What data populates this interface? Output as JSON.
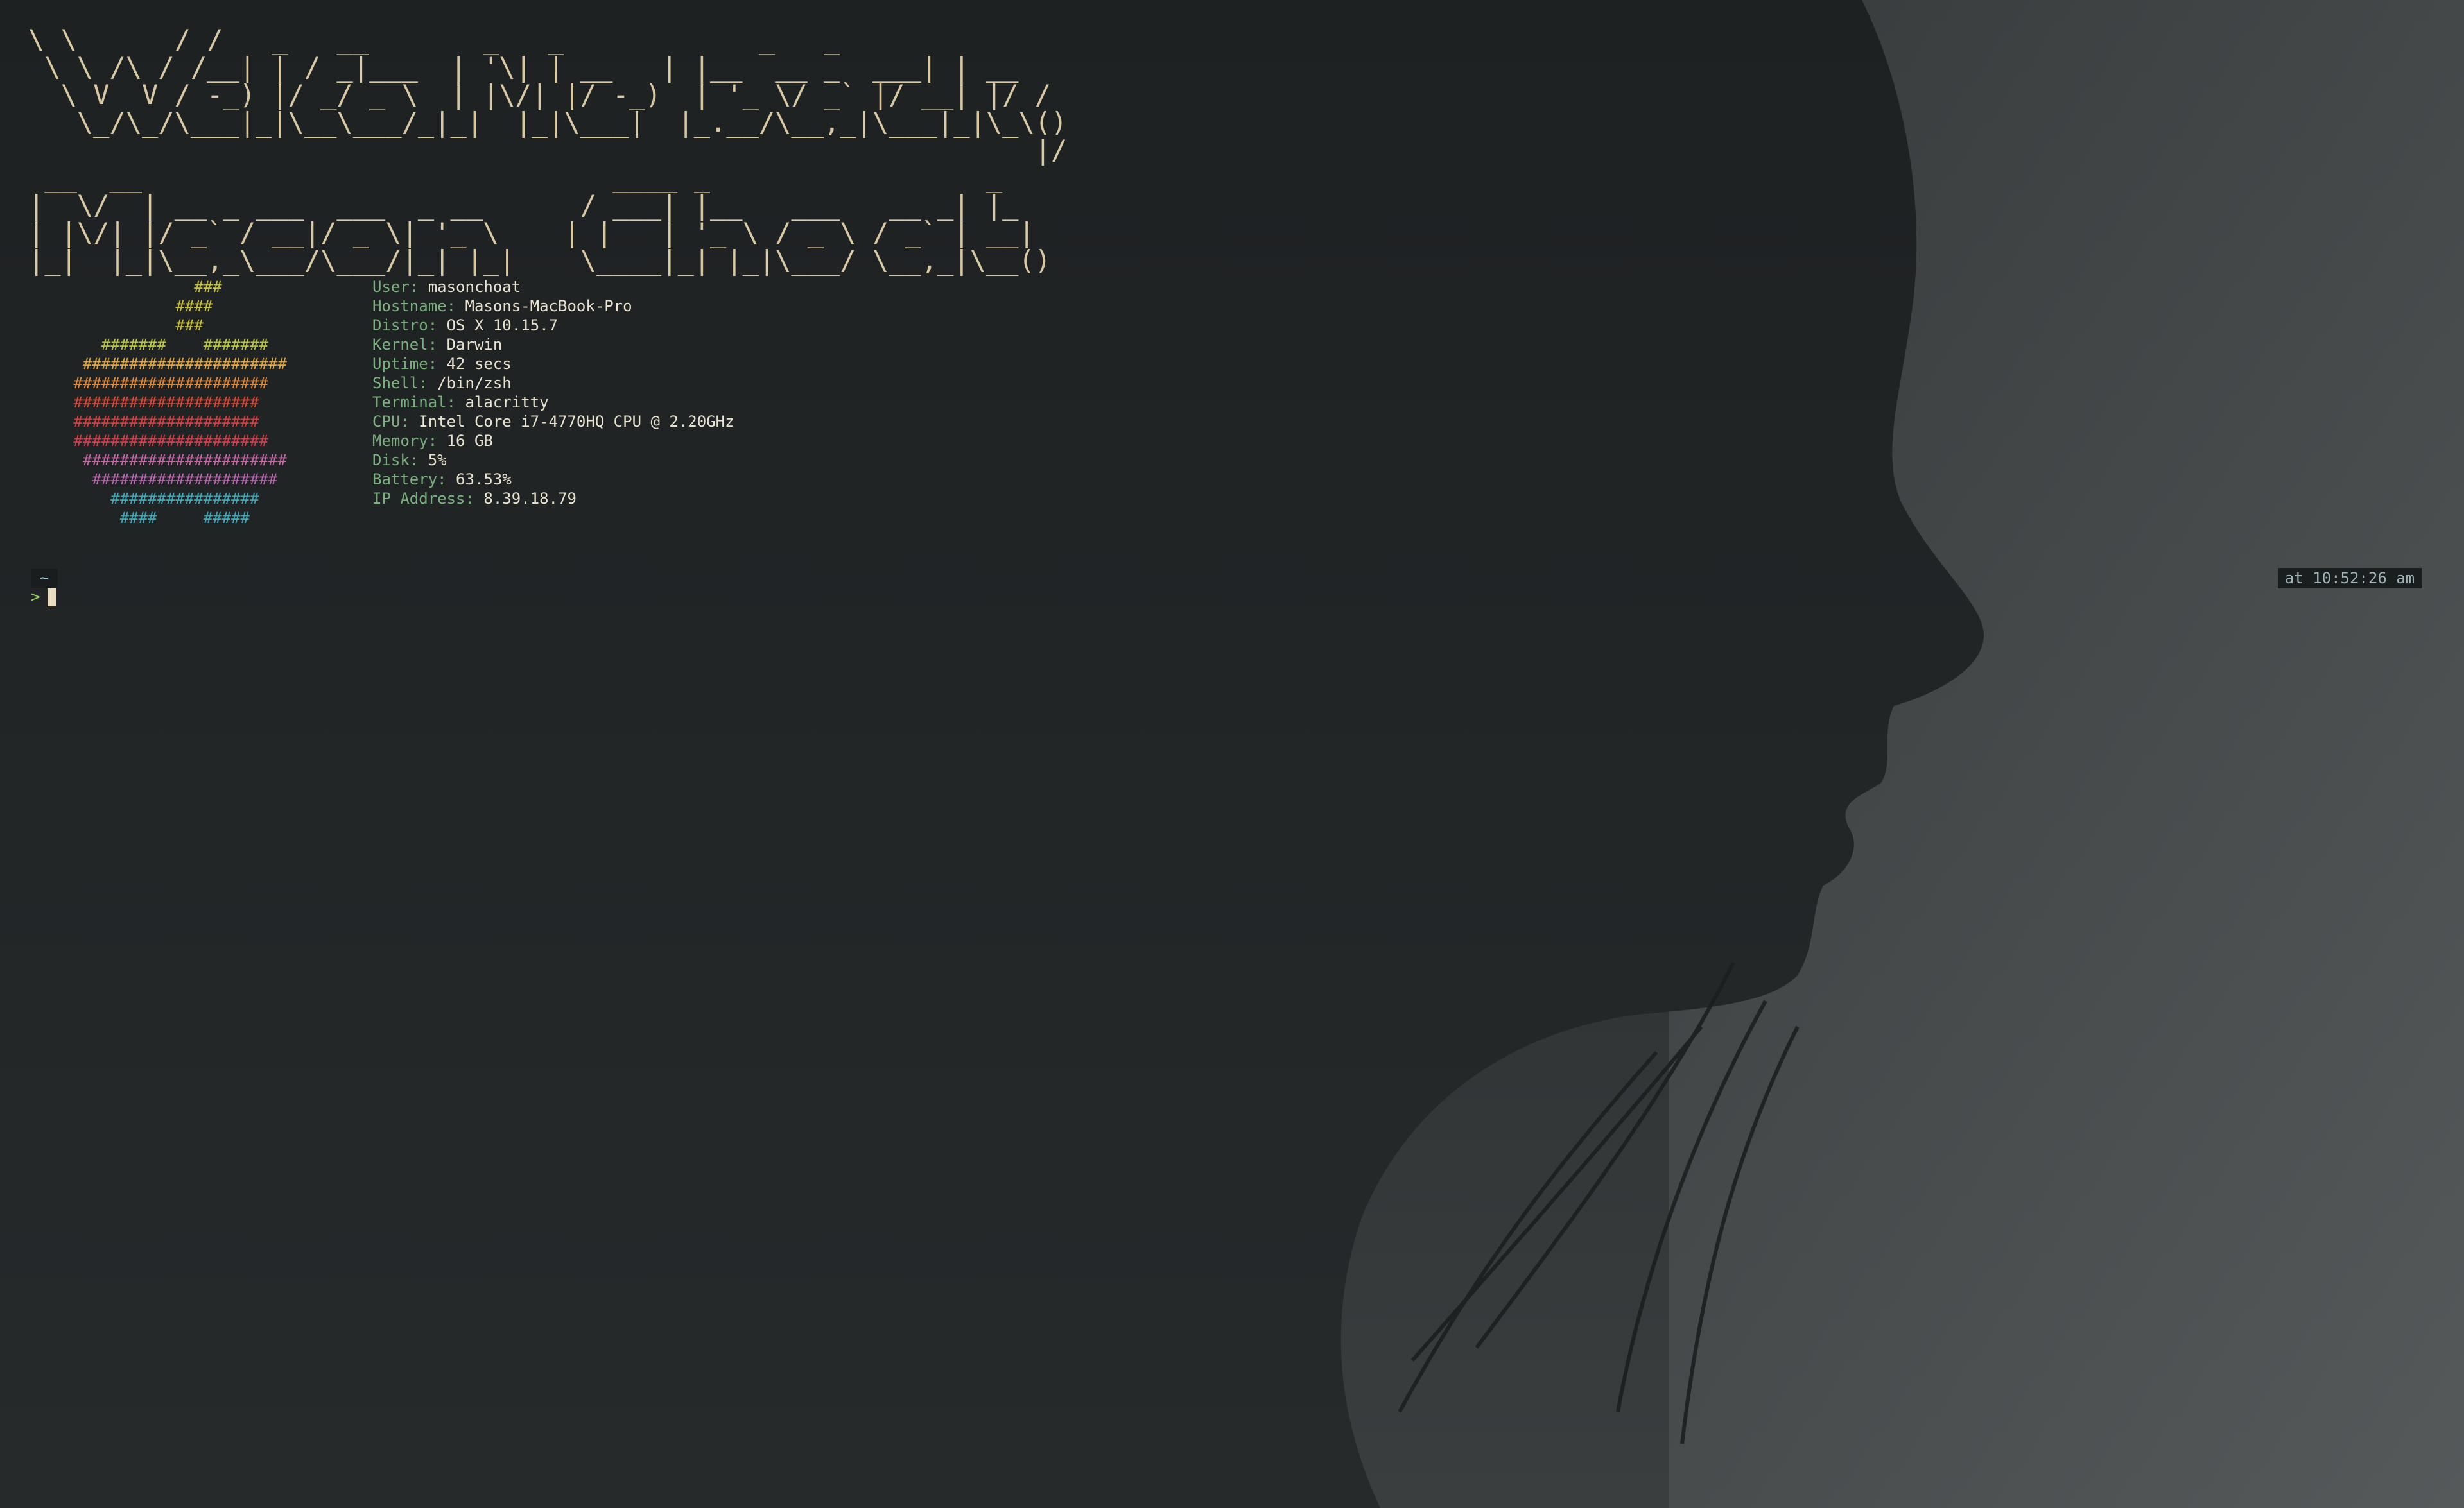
{
  "banner": {
    "lines": [
      "\\ \\      / /   _   __       _   _            _   _                 ",
      " \\ \\ /\\ / /__| | / _|___  | '\\| | __   | |__  __ _  ___| | __  ",
      "  \\ V  V / -_) |/ _/ _ \\  | |\\/| |/ -_)  | '_ \\/ _` |/ __| |/ /  ",
      "   \\_/\\_/\\___|_|\\__\\___/_|_|  |_|\\___|  |_.__/\\__,_|\\___|_|\\_\\()",
      "                                                              |/ ",
      " __  __                             ____ _                 _    ",
      "|  \\/  | __ _ ___  ___  _ __      / ___| |__   ___   __ _| |_  ",
      "| |\\/| |/ _` / __|/ _ \\| '_ \\    | |   | '_ \\ / _ \\ / _` | __| ",
      "|_|  |_|\\__,_\\___/\\___/|_| |_|    \\____|_| |_|\\___/ \\__,_|\\__()"
    ]
  },
  "logo": {
    "rows": [
      {
        "text": "              ###",
        "color": "#c9c23c"
      },
      {
        "text": "            ####",
        "color": "#c9c23c"
      },
      {
        "text": "            ###",
        "color": "#c9c23c"
      },
      {
        "text": "    #######    #######",
        "color": "#b9c43f"
      },
      {
        "text": "  ######################",
        "color": "#e0a63c"
      },
      {
        "text": " #####################",
        "color": "#e08a3c"
      },
      {
        "text": " ####################",
        "color": "#d84a3c"
      },
      {
        "text": " ####################",
        "color": "#d83c3c"
      },
      {
        "text": " #####################",
        "color": "#d83c4a"
      },
      {
        "text": "  ######################",
        "color": "#c66aa6"
      },
      {
        "text": "   ####################",
        "color": "#b86ab0"
      },
      {
        "text": "     ################",
        "color": "#3fa8b8"
      },
      {
        "text": "      ####     #####",
        "color": "#3fa8b8"
      }
    ]
  },
  "sysinfo": {
    "rows": [
      {
        "key": "User:",
        "value": "masonchoat"
      },
      {
        "key": "Hostname:",
        "value": "Masons-MacBook-Pro"
      },
      {
        "key": "Distro:",
        "value": "OS X 10.15.7"
      },
      {
        "key": "Kernel:",
        "value": "Darwin"
      },
      {
        "key": "Uptime:",
        "value": "42 secs"
      },
      {
        "key": "Shell:",
        "value": "/bin/zsh"
      },
      {
        "key": "Terminal:",
        "value": "alacritty"
      },
      {
        "key": "CPU:",
        "value": "Intel Core i7-4770HQ CPU @ 2.20GHz"
      },
      {
        "key": "Memory:",
        "value": "16 GB"
      },
      {
        "key": "Disk:",
        "value": "5%"
      },
      {
        "key": "Battery:",
        "value": "63.53%"
      },
      {
        "key": "IP Address:",
        "value": "8.39.18.79"
      }
    ]
  },
  "prompt": {
    "directory": "~",
    "arrow": ">",
    "time": "at 10:52:26 am"
  },
  "colors": {
    "banner": "#d9c9a3",
    "info_key": "#7ab07d",
    "info_value": "#e8e2cf",
    "prompt_arrow": "#8fd15a",
    "cursor": "#e8dcc0"
  }
}
